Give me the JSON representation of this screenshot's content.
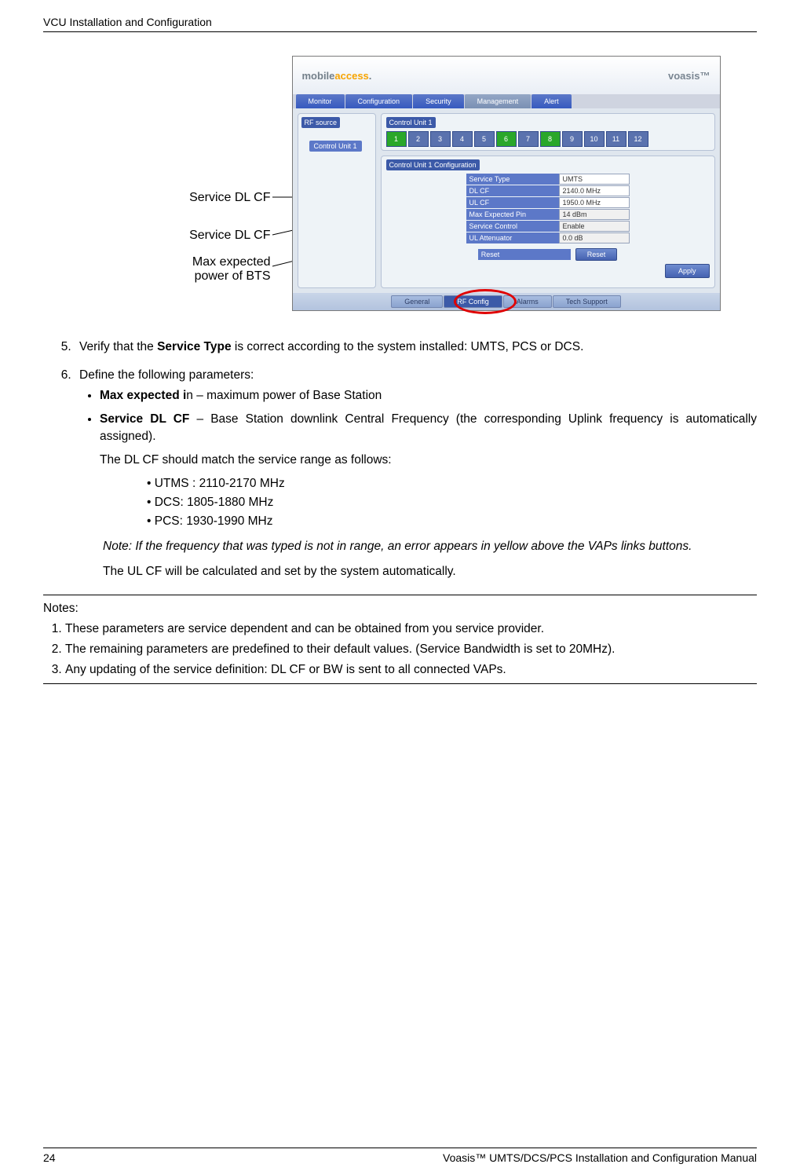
{
  "header": {
    "section": "VCU Installation and Configuration"
  },
  "callouts": {
    "c1": "Service DL CF",
    "c2": "Service DL CF",
    "c3a": "Max expected",
    "c3b": "power of BTS"
  },
  "app": {
    "brand_left_a": "mobile",
    "brand_left_b": "access",
    "brand_left_dot": ".",
    "brand_right": "voasis™",
    "topTabs": [
      "Monitor",
      "Configuration",
      "Security",
      "Management",
      "Alert"
    ],
    "sidebar": {
      "title": "RF source",
      "item": "Control Unit 1"
    },
    "panel1": {
      "title": "Control Unit 1"
    },
    "ports": [
      "1",
      "2",
      "3",
      "4",
      "5",
      "6",
      "7",
      "8",
      "9",
      "10",
      "11",
      "12"
    ],
    "greenPorts": [
      1,
      6,
      8
    ],
    "panel2": {
      "title": "Control Unit 1 Configuration",
      "rows": [
        {
          "label": "Service Type",
          "value": "UMTS"
        },
        {
          "label": "DL CF",
          "value": "2140.0  MHz"
        },
        {
          "label": "UL CF",
          "value": "1950.0  MHz"
        },
        {
          "label": "Max Expected Pin",
          "value": "14 dBm"
        },
        {
          "label": "Service Control",
          "value": "Enable"
        },
        {
          "label": "UL Attenuator",
          "value": "0.0 dB"
        }
      ],
      "resetLabel": "Reset",
      "resetBtn": "Reset",
      "applyBtn": "Apply"
    },
    "footer": [
      "General",
      "RF Config",
      "Alarms",
      "Tech Support"
    ]
  },
  "body": {
    "li5a": "Verify that the ",
    "li5b": "Service Type",
    "li5c": " is correct according to the system installed: UMTS, PCS or DCS.",
    "li6": "Define the following parameters:",
    "b1a": "Max expected i",
    "b1b": "n – maximum power of Base Station",
    "b2a": "Service DL CF",
    "b2b": " – Base Station downlink Central Frequency (the corresponding Uplink frequency is automatically assigned).",
    "b2p": "The DL CF should match the service range as follows:",
    "r1": "• UTMS : 2110-2170 MHz",
    "r2": "• DCS: 1805-1880 MHz",
    "r3": "• PCS: 1930-1990 MHz",
    "note_it": "Note: If the frequency that was typed is not in range, an error appears in yellow above the VAPs links buttons.",
    "last": "The UL CF will be calculated and set by the system automatically.",
    "notes_t": "Notes:",
    "n1": "These parameters are service dependent and can be obtained from you service provider.",
    "n2": "The remaining parameters are predefined to their default values. (Service Bandwidth is set to 20MHz).",
    "n3": "Any updating of the service definition: DL CF or BW is sent to all connected VAPs."
  },
  "footer": {
    "page": "24",
    "title": "Voasis™ UMTS/DCS/PCS Installation and Configuration Manual"
  }
}
